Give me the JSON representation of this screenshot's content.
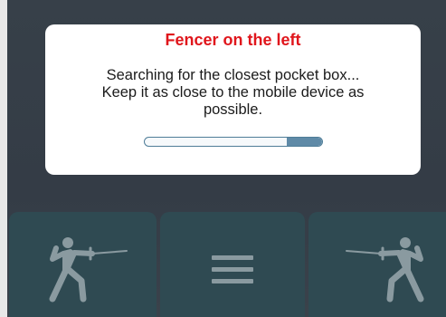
{
  "modal": {
    "title": "Fencer on the left",
    "message_line1": "Searching for the closest pocket box...",
    "message_line2": "Keep it as close to the mobile device as",
    "message_line3": "possible.",
    "progress_percent": 20
  },
  "bottom_bar": {
    "left_icon": "fencer-left-icon",
    "center_icon": "menu-icon",
    "right_icon": "fencer-right-icon"
  },
  "colors": {
    "title": "#e0161c",
    "tile": "#2f4a52",
    "icon": "#8a9aa0",
    "progress": "#5f8aa7"
  }
}
